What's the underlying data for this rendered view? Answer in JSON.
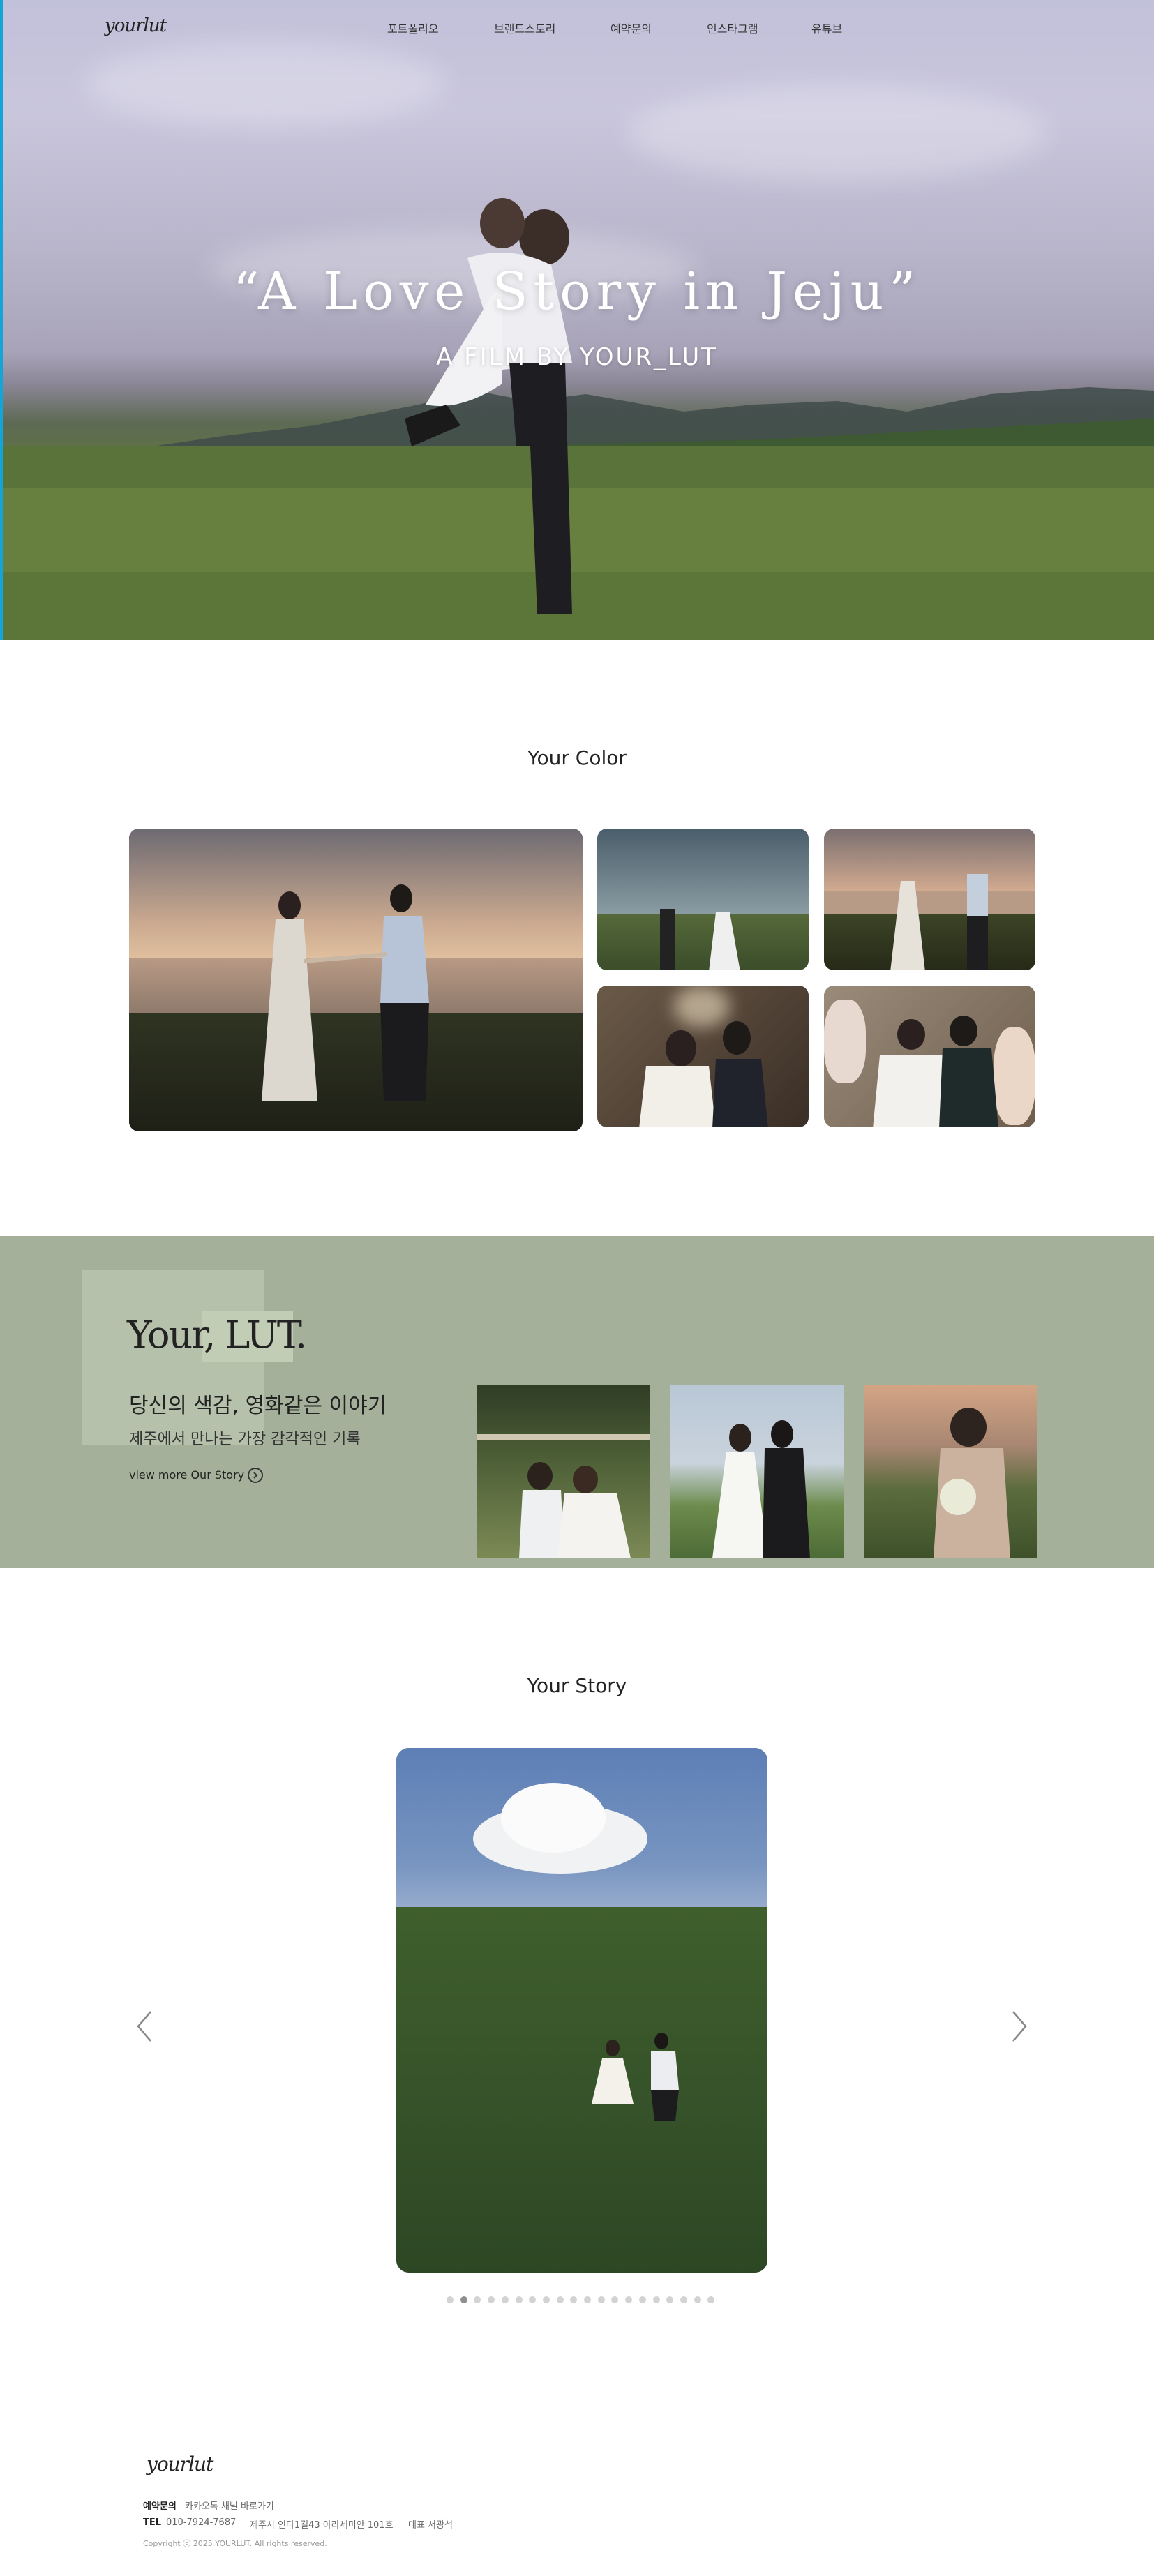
{
  "header": {
    "logo": "yourlut",
    "nav": [
      "포트폴리오",
      "브랜드스토리",
      "예약문의",
      "인스타그램",
      "유튜브"
    ]
  },
  "hero": {
    "title": "“A Love Story in Jeju”",
    "subtitle": "A FILM BY YOUR_LUT"
  },
  "color_section": {
    "title": "Your Color"
  },
  "lut_section": {
    "title": "Your, LUT.",
    "line1": "당신의 색감, 영화같은 이야기",
    "line2": "제주에서 만나는 가장 감각적인 기록",
    "more_label": "view more Our Story"
  },
  "story_section": {
    "title": "Your Story",
    "slide_count": 20,
    "active_slide": 1
  },
  "footer": {
    "logo": "yourlut",
    "contact_label": "예약문의",
    "kakao_text": "카카오톡 채널 바로가기",
    "tel_label": "TEL",
    "tel": "010-7924-7687",
    "address": "제주시 인다1길43 아라세미안 101호",
    "ceo": "대표 서광석",
    "copyright": "Copyright ⓒ 2025 YOURLUT. All rights reserved."
  },
  "colors": {
    "lut_band": "#a5b09b",
    "accent_edge": "#13a4d8"
  }
}
